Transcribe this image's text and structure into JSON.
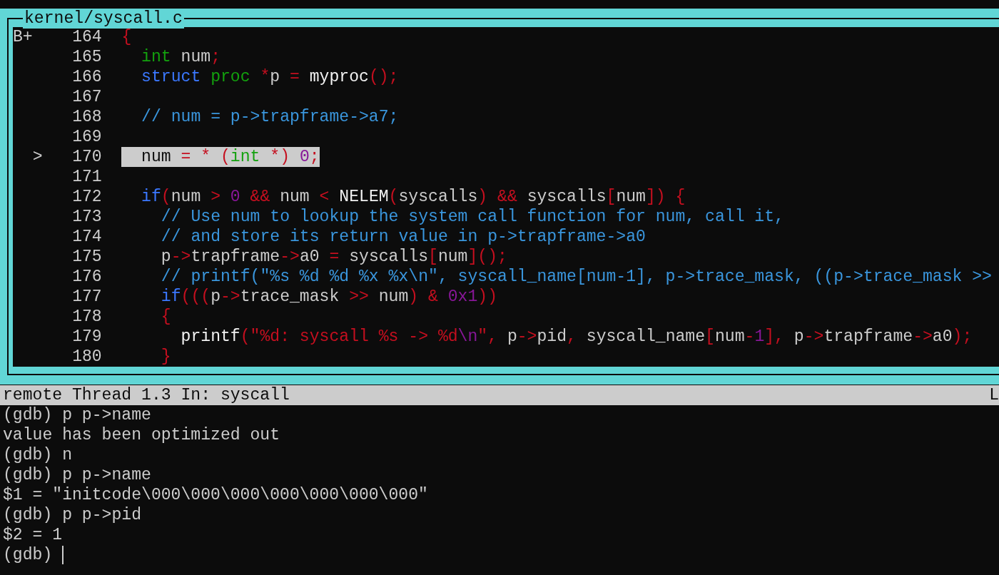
{
  "source_window": {
    "title": "kernel/syscall.c",
    "lines": [
      {
        "number": "164",
        "marker": {
          "kind": "breakpoint",
          "text": "B+"
        },
        "current": false,
        "tokens": [
          {
            "kind": "operator",
            "text": "{"
          }
        ]
      },
      {
        "number": "165",
        "current": false,
        "tokens": [
          {
            "kind": "type",
            "text": "  int"
          },
          {
            "kind": "plain",
            "text": " num"
          },
          {
            "kind": "operator",
            "text": ";"
          }
        ]
      },
      {
        "number": "166",
        "current": false,
        "tokens": [
          {
            "kind": "keyword",
            "text": "  struct"
          },
          {
            "kind": "type",
            "text": " proc"
          },
          {
            "kind": "operator",
            "text": " *"
          },
          {
            "kind": "plain",
            "text": "p "
          },
          {
            "kind": "operator",
            "text": "="
          },
          {
            "kind": "function",
            "text": " myproc"
          },
          {
            "kind": "operator",
            "text": "();"
          }
        ]
      },
      {
        "number": "167",
        "current": false
      },
      {
        "number": "168",
        "current": false,
        "tokens": [
          {
            "kind": "comment",
            "text": "  // num = p->trapframe->a7;"
          }
        ]
      },
      {
        "number": "169",
        "current": false
      },
      {
        "number": "170",
        "marker": {
          "kind": "current",
          "text": ">"
        },
        "current": true,
        "tokens": [
          {
            "kind": "plain",
            "text": "  num "
          },
          {
            "kind": "operator",
            "text": "= * ("
          },
          {
            "kind": "type",
            "text": "int"
          },
          {
            "kind": "operator",
            "text": " *) "
          },
          {
            "kind": "number",
            "text": "0"
          },
          {
            "kind": "operator",
            "text": ";"
          }
        ]
      },
      {
        "number": "171",
        "current": false
      },
      {
        "number": "172",
        "current": false,
        "tokens": [
          {
            "kind": "keyword",
            "text": "  if"
          },
          {
            "kind": "operator",
            "text": "("
          },
          {
            "kind": "plain",
            "text": "num "
          },
          {
            "kind": "operator",
            "text": ">"
          },
          {
            "kind": "number",
            "text": " 0"
          },
          {
            "kind": "operator",
            "text": " &&"
          },
          {
            "kind": "plain",
            "text": " num "
          },
          {
            "kind": "operator",
            "text": "<"
          },
          {
            "kind": "function",
            "text": " NELEM"
          },
          {
            "kind": "operator",
            "text": "("
          },
          {
            "kind": "plain",
            "text": "syscalls"
          },
          {
            "kind": "operator",
            "text": ") &&"
          },
          {
            "kind": "plain",
            "text": " syscalls"
          },
          {
            "kind": "operator",
            "text": "["
          },
          {
            "kind": "plain",
            "text": "num"
          },
          {
            "kind": "operator",
            "text": "]) {"
          }
        ]
      },
      {
        "number": "173",
        "current": false,
        "tokens": [
          {
            "kind": "comment",
            "text": "    // Use num to lookup the system call function for num, call it,"
          }
        ]
      },
      {
        "number": "174",
        "current": false,
        "tokens": [
          {
            "kind": "comment",
            "text": "    // and store its return value in p->trapframe->a0"
          }
        ]
      },
      {
        "number": "175",
        "current": false,
        "tokens": [
          {
            "kind": "plain",
            "text": "    p"
          },
          {
            "kind": "operator",
            "text": "->"
          },
          {
            "kind": "plain",
            "text": "trapframe"
          },
          {
            "kind": "operator",
            "text": "->"
          },
          {
            "kind": "plain",
            "text": "a0 "
          },
          {
            "kind": "operator",
            "text": "="
          },
          {
            "kind": "plain",
            "text": " syscalls"
          },
          {
            "kind": "operator",
            "text": "["
          },
          {
            "kind": "plain",
            "text": "num"
          },
          {
            "kind": "operator",
            "text": "]();"
          }
        ]
      },
      {
        "number": "176",
        "current": false,
        "tokens": [
          {
            "kind": "comment",
            "text": "    // printf(\"%s %d %d %x %x\\n\", syscall_name[num-1], p->trace_mask, ((p->trace_mask >>"
          }
        ]
      },
      {
        "number": "177",
        "current": false,
        "tokens": [
          {
            "kind": "keyword",
            "text": "    if"
          },
          {
            "kind": "operator",
            "text": "((("
          },
          {
            "kind": "plain",
            "text": "p"
          },
          {
            "kind": "operator",
            "text": "->"
          },
          {
            "kind": "plain",
            "text": "trace_mask "
          },
          {
            "kind": "operator",
            "text": ">>"
          },
          {
            "kind": "plain",
            "text": " num"
          },
          {
            "kind": "operator",
            "text": ") &"
          },
          {
            "kind": "number",
            "text": " 0x1"
          },
          {
            "kind": "operator",
            "text": "))"
          }
        ]
      },
      {
        "number": "178",
        "current": false,
        "tokens": [
          {
            "kind": "operator",
            "text": "    {"
          }
        ]
      },
      {
        "number": "179",
        "current": false,
        "tokens": [
          {
            "kind": "function",
            "text": "      printf"
          },
          {
            "kind": "operator",
            "text": "(\"%d: syscall %s -> %d"
          },
          {
            "kind": "number",
            "text": "\\n"
          },
          {
            "kind": "operator",
            "text": "\","
          },
          {
            "kind": "plain",
            "text": " p"
          },
          {
            "kind": "operator",
            "text": "->"
          },
          {
            "kind": "plain",
            "text": "pid"
          },
          {
            "kind": "operator",
            "text": ","
          },
          {
            "kind": "plain",
            "text": " syscall_name"
          },
          {
            "kind": "operator",
            "text": "["
          },
          {
            "kind": "plain",
            "text": "num"
          },
          {
            "kind": "operator",
            "text": "-"
          },
          {
            "kind": "number",
            "text": "1"
          },
          {
            "kind": "operator",
            "text": "],"
          },
          {
            "kind": "plain",
            "text": " p"
          },
          {
            "kind": "operator",
            "text": "->"
          },
          {
            "kind": "plain",
            "text": "trapframe"
          },
          {
            "kind": "operator",
            "text": "->"
          },
          {
            "kind": "plain",
            "text": "a0"
          },
          {
            "kind": "operator",
            "text": ");"
          }
        ]
      },
      {
        "number": "180",
        "current": false,
        "tokens": [
          {
            "kind": "operator",
            "text": "    }"
          }
        ]
      }
    ]
  },
  "status_bar": {
    "text": "remote Thread 1.3 In: syscall",
    "right": "L"
  },
  "console": {
    "lines": [
      "(gdb) p p->name",
      "value has been optimized out",
      "(gdb) n",
      "(gdb) p p->name",
      "$1 = \"initcode\\000\\000\\000\\000\\000\\000\\000\"",
      "(gdb) p p->pid",
      "$2 = 1"
    ],
    "prompt": "(gdb)"
  }
}
